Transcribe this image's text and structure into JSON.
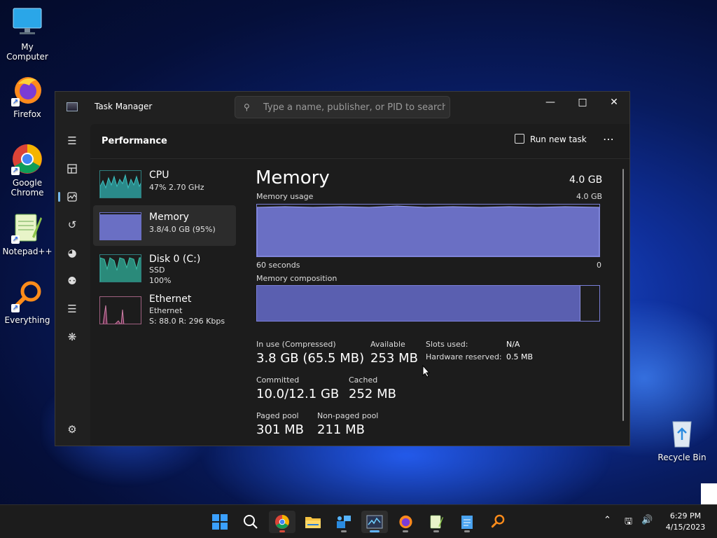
{
  "desktop": {
    "icons": [
      {
        "label": "My Computer"
      },
      {
        "label": "Firefox"
      },
      {
        "label": "Google Chrome"
      },
      {
        "label": "Notepad++"
      },
      {
        "label": "Everything"
      },
      {
        "label": "Recycle Bin"
      }
    ]
  },
  "window": {
    "title": "Task Manager",
    "search_placeholder": "Type a name, publisher, or PID to search"
  },
  "sidebar": {
    "items": [
      {
        "icon": "hamburger-icon"
      },
      {
        "icon": "processes-icon"
      },
      {
        "icon": "performance-icon",
        "active": true
      },
      {
        "icon": "app-history-icon"
      },
      {
        "icon": "startup-apps-icon"
      },
      {
        "icon": "users-icon"
      },
      {
        "icon": "details-icon"
      },
      {
        "icon": "services-icon"
      },
      {
        "icon": "settings-icon"
      }
    ]
  },
  "header": {
    "page_title": "Performance",
    "run_new_task": "Run new task",
    "more": "⋯"
  },
  "resources": [
    {
      "name": "CPU",
      "line1": "47% 2.70 GHz",
      "line2": ""
    },
    {
      "name": "Memory",
      "line1": "3.8/4.0 GB (95%)",
      "line2": ""
    },
    {
      "name": "Disk 0 (C:)",
      "line1": "SSD",
      "line2": "100%"
    },
    {
      "name": "Ethernet",
      "line1": "Ethernet",
      "line2": "S: 88.0  R: 296 Kbps"
    }
  ],
  "memory": {
    "title": "Memory",
    "total": "4.0 GB",
    "usage_label": "Memory usage",
    "usage_max": "4.0 GB",
    "time_label": "60 seconds",
    "time_min": "0",
    "composition_label": "Memory composition",
    "composition_in_use_fraction": 0.944,
    "stats": {
      "in_use_label": "In use (Compressed)",
      "in_use_value": "3.8 GB (65.5 MB)",
      "available_label": "Available",
      "available_value": "253 MB",
      "committed_label": "Committed",
      "committed_value": "10.0/12.1 GB",
      "cached_label": "Cached",
      "cached_value": "252 MB",
      "paged_label": "Paged pool",
      "paged_value": "301 MB",
      "nonpaged_label": "Non-paged pool",
      "nonpaged_value": "211 MB",
      "slots_label": "Slots used:",
      "slots_value": "N/A",
      "hw_reserved_label": "Hardware reserved:",
      "hw_reserved_value": "0.5 MB"
    }
  },
  "taskbar": {
    "time": "6:29 PM",
    "date": "4/15/2023"
  },
  "colors": {
    "accent": "#60b3ff",
    "memory_fill": "#6a6fc4",
    "cpu_fill": "#2f9e9e",
    "ethernet_line": "#d080a8"
  }
}
